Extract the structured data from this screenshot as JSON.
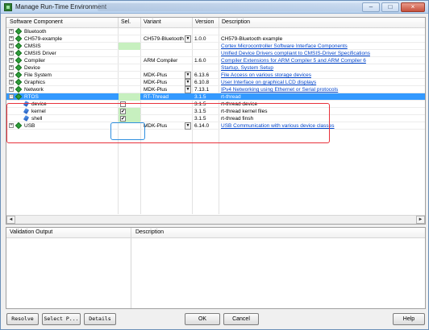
{
  "window": {
    "title": "Manage Run-Time Environment"
  },
  "titlebar_controls": {
    "minimize": "–",
    "maximize": "□",
    "close": "×"
  },
  "grid": {
    "columns": [
      "Software Component",
      "Sel.",
      "Variant",
      "Version",
      "Description"
    ],
    "rows": [
      {
        "name": "Bluetooth",
        "level": 0,
        "exp": "+",
        "icon": "diamond",
        "sel_green": false,
        "check": null,
        "variant": "",
        "dropdown": false,
        "version": "",
        "description": "",
        "link": false
      },
      {
        "name": "CH579-example",
        "level": 0,
        "exp": "+",
        "icon": "diamond",
        "sel_green": false,
        "check": null,
        "variant": "CH579-Bluetooth",
        "dropdown": true,
        "version": "1.0.0",
        "description": "CH579-Bluetooth example",
        "link": false
      },
      {
        "name": "CMSIS",
        "level": 0,
        "exp": "+",
        "icon": "diamond",
        "sel_green": true,
        "check": null,
        "variant": "",
        "dropdown": false,
        "version": "",
        "description": "Cortex Microcontroller Software Interface Components",
        "link": true
      },
      {
        "name": "CMSIS Driver",
        "level": 0,
        "exp": "+",
        "icon": "diamond",
        "sel_green": false,
        "check": null,
        "variant": "",
        "dropdown": false,
        "version": "",
        "description": "Unified Device Drivers compliant to CMSIS-Driver Specifications",
        "link": true
      },
      {
        "name": "Compiler",
        "level": 0,
        "exp": "+",
        "icon": "diamond",
        "sel_green": false,
        "check": null,
        "variant": "ARM Compiler",
        "dropdown": false,
        "version": "1.6.0",
        "description": "Compiler Extensions for ARM Compiler 5 and ARM Compiler 6",
        "link": true
      },
      {
        "name": "Device",
        "level": 0,
        "exp": "+",
        "icon": "diamond",
        "sel_green": false,
        "check": null,
        "variant": "",
        "dropdown": false,
        "version": "",
        "description": "Startup, System Setup",
        "link": true
      },
      {
        "name": "File System",
        "level": 0,
        "exp": "+",
        "icon": "diamond",
        "sel_green": false,
        "check": null,
        "variant": "MDK-Plus",
        "dropdown": true,
        "version": "6.13.6",
        "description": "File Access on various storage devices",
        "link": true
      },
      {
        "name": "Graphics",
        "level": 0,
        "exp": "+",
        "icon": "diamond",
        "sel_green": false,
        "check": null,
        "variant": "MDK-Plus",
        "dropdown": true,
        "version": "6.10.8",
        "description": "User Interface on graphical LCD displays",
        "link": true
      },
      {
        "name": "Network",
        "level": 0,
        "exp": "+",
        "icon": "diamond",
        "sel_green": false,
        "check": null,
        "variant": "MDK-Plus",
        "dropdown": true,
        "version": "7.13.1",
        "description": "IPv4 Networking using Ethernet or Serial protocols",
        "link": true
      },
      {
        "name": "RTOS",
        "level": 0,
        "exp": "−",
        "icon": "diamond",
        "sel_green": true,
        "check": null,
        "variant": "RT-Thread",
        "dropdown": false,
        "version": "3.1.5",
        "description": "rt-thread",
        "link": false,
        "selected": true
      },
      {
        "name": "device",
        "level": 1,
        "exp": "",
        "icon": "gem",
        "sel_green": false,
        "check": "",
        "variant": "",
        "dropdown": false,
        "version": "3.1.5",
        "description": "rt-thread device",
        "link": false
      },
      {
        "name": "kernel",
        "level": 1,
        "exp": "",
        "icon": "gem",
        "sel_green": true,
        "check": "✔",
        "variant": "",
        "dropdown": false,
        "version": "3.1.5",
        "description": "rt-thread kernel files",
        "link": false
      },
      {
        "name": "shell",
        "level": 1,
        "exp": "",
        "icon": "gem",
        "sel_green": true,
        "check": "✔",
        "variant": "",
        "dropdown": false,
        "version": "3.1.5",
        "description": "rt-thread finsh",
        "link": false
      },
      {
        "name": "USB",
        "level": 0,
        "exp": "+",
        "icon": "diamond",
        "sel_green": false,
        "check": null,
        "variant": "MDK-Plus",
        "dropdown": true,
        "version": "6.14.0",
        "description": "USB Communication with various device classes",
        "link": true
      }
    ]
  },
  "validation": {
    "columns": [
      "Validation Output",
      "Description"
    ]
  },
  "buttons": {
    "resolve": "Resolve",
    "select_p": "Select P...",
    "details": "Details",
    "ok": "OK",
    "cancel": "Cancel",
    "help": "Help"
  },
  "scroll": {
    "left": "◄",
    "right": "►"
  }
}
